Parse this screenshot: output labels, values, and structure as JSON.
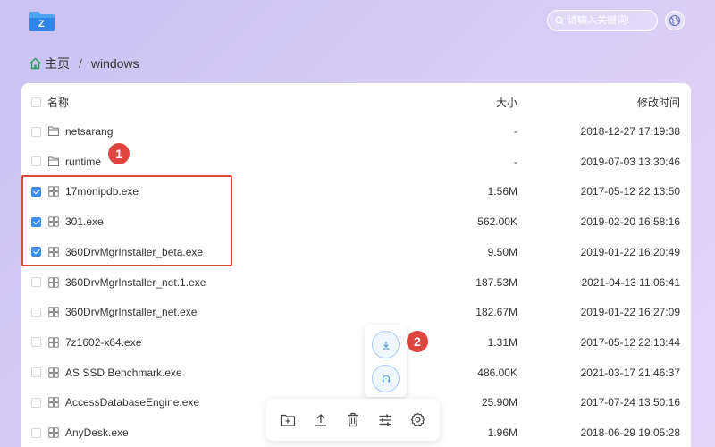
{
  "app": {
    "logo_letter": "Z",
    "brand_color": "#2f86e8"
  },
  "search": {
    "placeholder": "请输入关键词!"
  },
  "breadcrumb": {
    "home": "主页",
    "separator": "/",
    "current": "windows"
  },
  "table": {
    "headers": {
      "name": "名称",
      "size": "大小",
      "modified": "修改时间"
    },
    "rows": [
      {
        "name": "netsarang",
        "type": "folder",
        "size": "-",
        "modified": "2018-12-27 17:19:38",
        "checked": false
      },
      {
        "name": "runtime",
        "type": "folder",
        "size": "-",
        "modified": "2019-07-03 13:30:46",
        "checked": false
      },
      {
        "name": "17monipdb.exe",
        "type": "exe",
        "size": "1.56M",
        "modified": "2017-05-12 22:13:50",
        "checked": true
      },
      {
        "name": "301.exe",
        "type": "exe",
        "size": "562.00K",
        "modified": "2019-02-20 16:58:16",
        "checked": true
      },
      {
        "name": "360DrvMgrInstaller_beta.exe",
        "type": "exe",
        "size": "9.50M",
        "modified": "2019-01-22 16:20:49",
        "checked": true
      },
      {
        "name": "360DrvMgrInstaller_net.1.exe",
        "type": "exe",
        "size": "187.53M",
        "modified": "2021-04-13 11:06:41",
        "checked": false
      },
      {
        "name": "360DrvMgrInstaller_net.exe",
        "type": "exe",
        "size": "182.67M",
        "modified": "2019-01-22 16:27:09",
        "checked": false
      },
      {
        "name": "7z1602-x64.exe",
        "type": "exe",
        "size": "1.31M",
        "modified": "2017-05-12 22:13:44",
        "checked": false
      },
      {
        "name": "AS SSD Benchmark.exe",
        "type": "exe",
        "size": "486.00K",
        "modified": "2021-03-17 21:46:37",
        "checked": false
      },
      {
        "name": "AccessDatabaseEngine.exe",
        "type": "exe",
        "size": "25.90M",
        "modified": "2017-07-24 13:50:16",
        "checked": false
      },
      {
        "name": "AnyDesk.exe",
        "type": "exe",
        "size": "1.96M",
        "modified": "2018-06-29 19:05:28",
        "checked": false
      }
    ]
  },
  "annotations": {
    "badge1": "1",
    "badge2": "2",
    "highlight_color": "#e0453f"
  },
  "float_actions": [
    "download-icon",
    "headset-icon"
  ],
  "toolbar": [
    "new-folder-icon",
    "upload-icon",
    "trash-icon",
    "sliders-icon",
    "gear-icon"
  ]
}
